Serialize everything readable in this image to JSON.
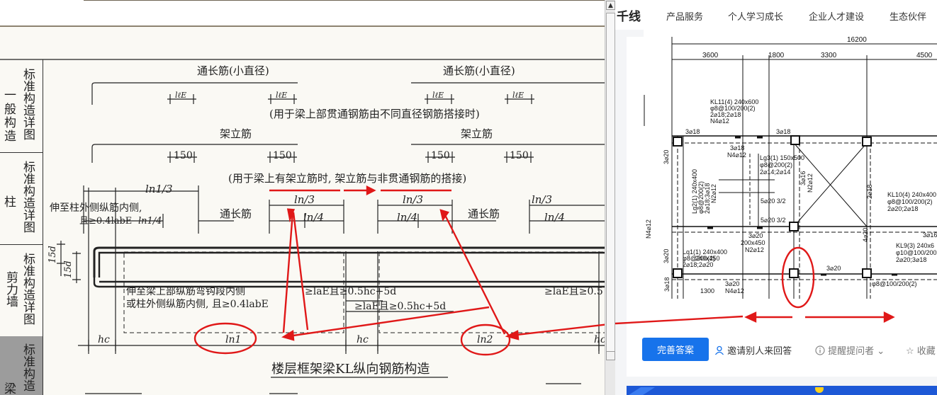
{
  "left_doc": {
    "side_sections": [
      {
        "label_a": "一",
        "label_b": "般",
        "label_c": "构",
        "label_d": "造",
        "vertical": "标准构造详图"
      },
      {
        "label_a": "柱",
        "vertical": "标准构造详图"
      },
      {
        "label_a": "剪力墙",
        "vertical": "标准构造详图"
      },
      {
        "label_a": "梁",
        "vertical": "标准构造"
      }
    ],
    "labels": {
      "through_bar_small_1": "通长筋(小直径)",
      "through_bar_small_2": "通长筋(小直径)",
      "lle": "lℓE",
      "note_1": "(用于梁上部贯通钢筋由不同直径钢筋搭接时)",
      "erection_bar_1": "架立筋",
      "erection_bar_2": "架立筋",
      "dim_150": "150",
      "note_2": "(用于梁上有架立筋时, 架立筋与非贯通钢筋的搭接)",
      "ln1_3": "ln1/3",
      "ln_3": "ln/3",
      "ln_4": "ln/4",
      "col_extend_1": "伸至柱外侧纵筋内侧,",
      "col_extend_2": "且≥0.4labE",
      "ln1_4": "ln1/4",
      "through_bar_1": "通长筋",
      "through_bar_2": "通长筋",
      "d15": "15d",
      "hook_1": "伸至梁上部纵筋弯钩段内侧",
      "hook_2": "或柱外侧纵筋内侧, 且≥0.4labE",
      "lae_1": "≥laE且≥0.5hc+5d",
      "lae_2": "≥laE且≥0.5hc+5d",
      "lae_3": "≥laE且≥0.5",
      "hc": "hc",
      "ln1": "ln1",
      "ln2": "ln2",
      "caption": "楼层框架梁KL纵向钢筋构造"
    }
  },
  "right_site": {
    "brand": "千线",
    "nav": [
      "产品服务",
      "个人学习成长",
      "企业人才建设",
      "生态伙伴"
    ],
    "plan": {
      "total_dim": "16200",
      "spans": [
        "3600",
        "1800",
        "3300",
        "4500"
      ],
      "labels": {
        "kl11_a": "KL11(4) 240x600",
        "kl11_b": "φ8@100/200(2)",
        "kl11_c": "2⌀18;2⌀18",
        "kl11_d": "N4⌀12",
        "b318_1": "3⌀18",
        "b318_2": "3⌀18",
        "b318_3": "3⌀18",
        "n412": "N4⌀12",
        "lg3_a": "Lg3(1) 150x500",
        "lg3_b": "φ8@200(2)",
        "lg3_c": "2⌀14;2⌀14",
        "lg2_a": "Lg2(1) 240x400",
        "lg2_b": "φ8@200(2)",
        "lg2_c": "2⌀18;3⌀18",
        "lg2_d": "N2⌀12",
        "b320_1": "3⌀20",
        "b320_2": "5⌀20 3/2",
        "b320_3": "5⌀20 3/2",
        "kl10_a": "KL10(4) 240x400",
        "kl10_b": "φ8@100/200(2)",
        "kl10_c": "2⌀20;2⌀18",
        "b316": "3⌀16",
        "n212": "N2⌀12",
        "b200": "200x450",
        "lq1_a": "Lq1(1) 240x400",
        "lq1_b": "φ8@200(2)",
        "lq1_c": "2⌀18;2⌀20",
        "b240": "240x450",
        "kl9_a": "KL9(3) 240x6",
        "kl9_b": "φ10@100/200",
        "kl9_c": "2⌀20;3⌀18",
        "b1300": "1300",
        "b320_4": "3⌀20",
        "n412_2": "N4⌀12",
        "bot": "φ8@100/200(2)",
        "b318_4": "3⌀18",
        "b320_5": "3⌀20",
        "b420": "4⌀20",
        "b218": "2⌀18",
        "b316_2": "3⌀16",
        "n2": "N2⌀12",
        "l_side": "N4⌀12"
      }
    },
    "actions": {
      "answer": "完善答案",
      "invite": "邀请别人来回答",
      "remind": "提醒提问者",
      "collect": "收藏"
    }
  },
  "colors": {
    "annotation_red": "#e01818",
    "primary_blue": "#1773eb",
    "side_dark": "#9c9c9c"
  }
}
